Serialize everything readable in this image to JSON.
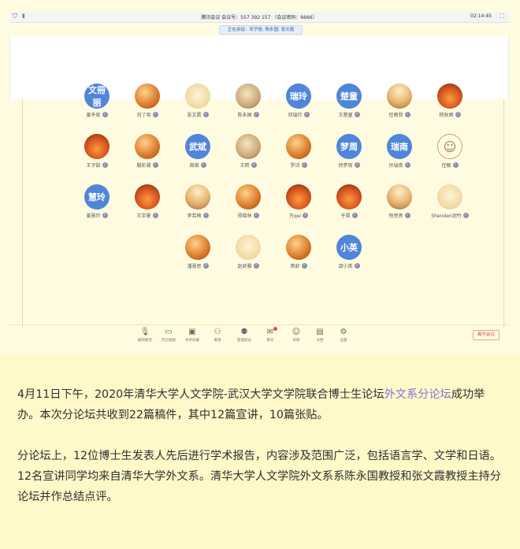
{
  "meeting": {
    "title_bar": "腾讯会议  会议号：557 392 157  （会议密码：6666）",
    "time": "02:14:45",
    "speaking_label": "正在讲话：邓子晗; 陈永国; 张文霞"
  },
  "participants": [
    {
      "name": "姜冬俊",
      "avatar_text": "文冊 丽",
      "avatar_style": "text"
    },
    {
      "name": "刘了哈",
      "avatar_text": "",
      "avatar_style": "photo"
    },
    {
      "name": "张文霞",
      "avatar_text": "",
      "avatar_style": "photo5"
    },
    {
      "name": "陈永国",
      "avatar_text": "",
      "avatar_style": "photo4"
    },
    {
      "name": "邓瑞玲",
      "avatar_text": "瑞玲",
      "avatar_style": "text"
    },
    {
      "name": "王楚童",
      "avatar_text": "楚童",
      "avatar_style": "text"
    },
    {
      "name": "任雨菲",
      "avatar_text": "",
      "avatar_style": "photo2"
    },
    {
      "name": "杨秋雨",
      "avatar_text": "",
      "avatar_style": "photo3"
    },
    {
      "name": "王子甜",
      "avatar_text": "",
      "avatar_style": "photo3"
    },
    {
      "name": "殷彩凝",
      "avatar_text": "",
      "avatar_style": "photo"
    },
    {
      "name": "周斌",
      "avatar_text": "武斌",
      "avatar_style": "text"
    },
    {
      "name": "王熙",
      "avatar_text": "",
      "avatar_style": "photo4"
    },
    {
      "name": "罗诗",
      "avatar_text": "",
      "avatar_style": "photo"
    },
    {
      "name": "徐梦周",
      "avatar_text": "梦周",
      "avatar_style": "text"
    },
    {
      "name": "孙瑞南",
      "avatar_text": "瑞南",
      "avatar_style": "text"
    },
    {
      "name": "任敏",
      "avatar_text": "☺",
      "avatar_style": "face"
    },
    {
      "name": "姜慧玲",
      "avatar_text": "慧玲",
      "avatar_style": "text"
    },
    {
      "name": "王宇豪",
      "avatar_text": "",
      "avatar_style": "photo3"
    },
    {
      "name": "李若楠",
      "avatar_text": "",
      "avatar_style": "photo2"
    },
    {
      "name": "郑晓林",
      "avatar_text": "",
      "avatar_style": "photo"
    },
    {
      "name": "万qei",
      "avatar_text": "",
      "avatar_style": "photo3"
    },
    {
      "name": "于昊",
      "avatar_text": "",
      "avatar_style": "photo3"
    },
    {
      "name": "徐亮亮",
      "avatar_text": "",
      "avatar_style": "photo2"
    },
    {
      "name": "Shenden润竹",
      "avatar_text": "",
      "avatar_style": "photo5"
    },
    {
      "name": "潘慧思",
      "avatar_text": "",
      "avatar_style": "photo"
    },
    {
      "name": "赵舒雅",
      "avatar_text": "",
      "avatar_style": "photo5"
    },
    {
      "name": "蒋舒",
      "avatar_text": "",
      "avatar_style": "photo"
    },
    {
      "name": "邵小英",
      "avatar_text": "小英",
      "avatar_style": "text"
    }
  ],
  "toolbar": [
    {
      "label": "解除静音",
      "icon": "mic-icon"
    },
    {
      "label": "开启视频",
      "icon": "video-icon"
    },
    {
      "label": "共享屏幕",
      "icon": "share-screen-icon"
    },
    {
      "label": "邀请",
      "icon": "invite-icon"
    },
    {
      "label": "管理成员",
      "icon": "members-icon"
    },
    {
      "label": "聊天",
      "icon": "chat-icon"
    },
    {
      "label": "表情",
      "icon": "emoji-icon"
    },
    {
      "label": "文档",
      "icon": "document-icon"
    },
    {
      "label": "设置",
      "icon": "settings-icon"
    }
  ],
  "leave_button": "离开会议",
  "article": {
    "p1_before": "4月11日下午，2020年清华大学人文学院-武汉大学文学院联合博士生论坛",
    "p1_accent": "外文系分论坛",
    "p1_after": "成功举办。本次分论坛共收到22篇稿件，其中12篇宣讲，10篇张贴。",
    "p2": "分论坛上，12位博士生发表人先后进行学术报告，内容涉及范围广泛，包括语言学、文学和日语。12名宣讲同学均来自清华大学外文系。清华大学人文学院外文系系陈永国教授和张文霞教授主持分论坛并作总结点评。"
  },
  "colors": {
    "accent": "#8a6ed8",
    "avatar_blue": "#4f86d9",
    "background": "#fff8c9"
  }
}
